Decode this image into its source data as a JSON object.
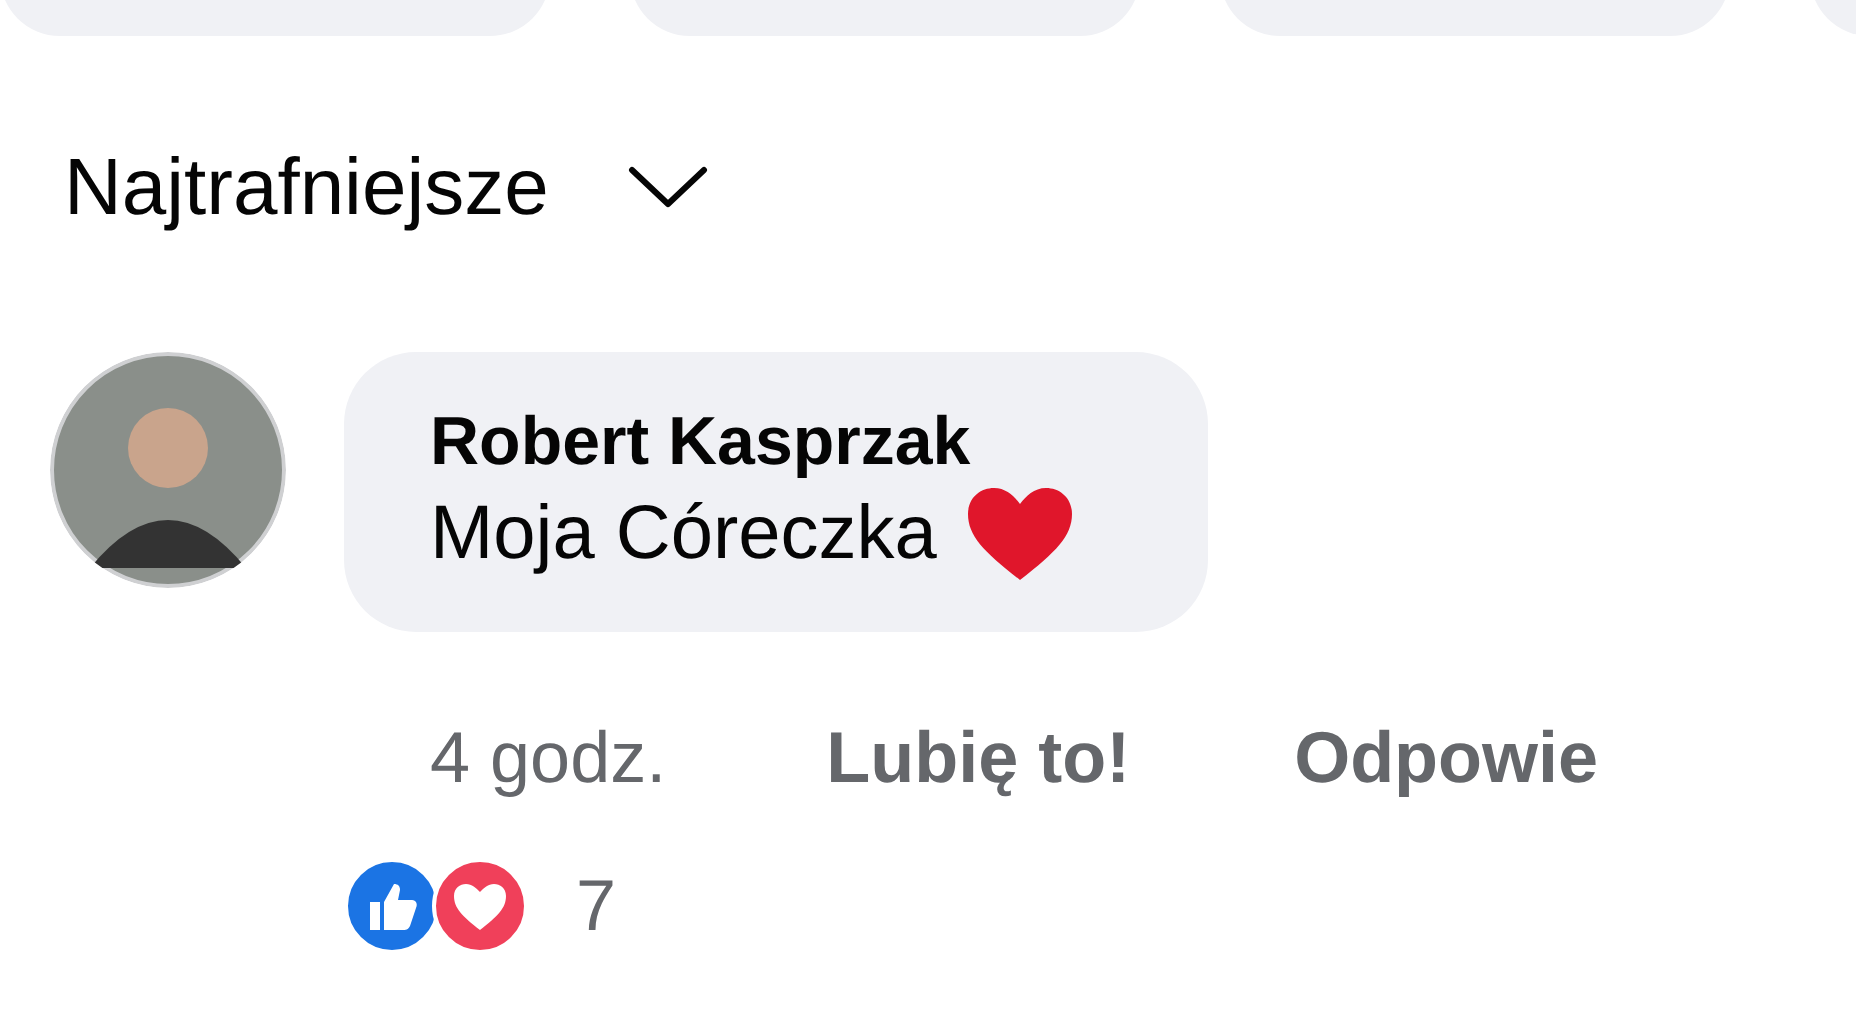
{
  "top_chips": [
    {
      "kind": "chip"
    },
    {
      "kind": "chip"
    },
    {
      "kind": "chip"
    },
    {
      "kind": "chip"
    }
  ],
  "sort": {
    "label": "Najtrafniejsze"
  },
  "comment": {
    "author": "Robert Kasprzak",
    "text": "Moja Córeczka",
    "time": "4 godz.",
    "actions": [
      "Lubię to!",
      "Odpowie"
    ],
    "reactions": [
      {
        "kind": "like"
      },
      {
        "kind": "love"
      }
    ],
    "reaction_count": "7"
  }
}
